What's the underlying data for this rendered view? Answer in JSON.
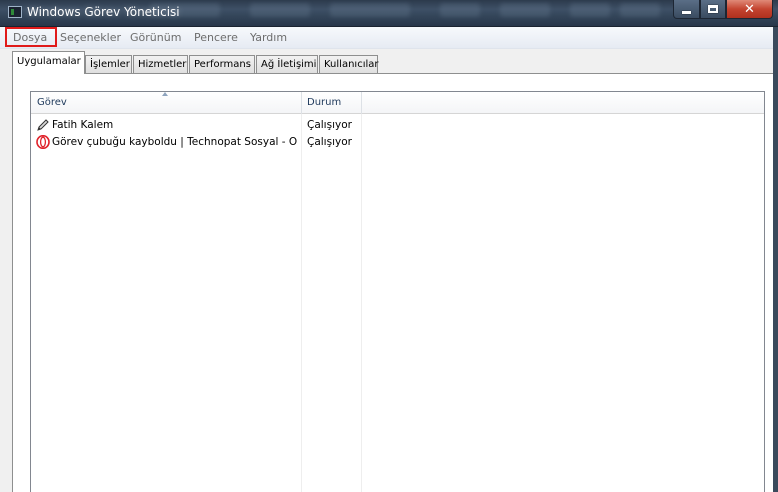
{
  "window": {
    "title": "Windows Görev Yöneticisi"
  },
  "menu": {
    "items": [
      "Dosya",
      "Seçenekler",
      "Görünüm",
      "Pencere",
      "Yardım"
    ],
    "highlighted": "Dosya"
  },
  "tabs": [
    "Uygulamalar",
    "İşlemler",
    "Hizmetler",
    "Performans",
    "Ağ İletişimi",
    "Kullanıcılar"
  ],
  "active_tab": "Uygulamalar",
  "list": {
    "columns": [
      "Görev",
      "Durum"
    ],
    "rows": [
      {
        "name": "Fatih Kalem",
        "status": "Çalışıyor",
        "icon": "pen-icon"
      },
      {
        "name": "Görev çubuğu kayboldu | Technopat Sosyal - Op...",
        "status": "Çalışıyor",
        "icon": "opera-icon"
      }
    ]
  },
  "colors": {
    "highlight_box": "#e01a1a",
    "header_text": "#1e395b"
  }
}
